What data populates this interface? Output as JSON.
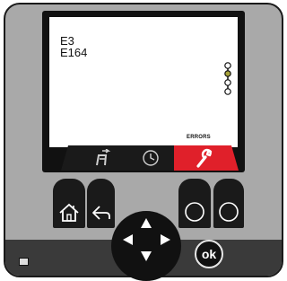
{
  "screen": {
    "lines": [
      "E3",
      "E164"
    ],
    "level_indicator": {
      "dots": 4,
      "active_index": 1
    }
  },
  "tabs": [
    {
      "icon": "service-icon",
      "active": false
    },
    {
      "icon": "clock-icon",
      "active": false
    },
    {
      "icon": "wrench-icon",
      "active": true,
      "label": "ERRORS"
    }
  ],
  "softkeys": {
    "left": [
      {
        "icon": "home-icon"
      },
      {
        "icon": "back-arrow-icon"
      }
    ],
    "right": [
      {
        "icon": "circle-icon"
      },
      {
        "icon": "circle-icon"
      }
    ]
  },
  "dpad": {
    "directions": [
      "up",
      "left",
      "right",
      "down"
    ]
  },
  "ok_button": {
    "label": "ok"
  },
  "status": {
    "icon": "status-icon"
  },
  "colors": {
    "body": "#a9a9a9",
    "bezel": "#111111",
    "accent_active_tab": "#e0202a",
    "bottom_band": "#3a3a3a"
  }
}
